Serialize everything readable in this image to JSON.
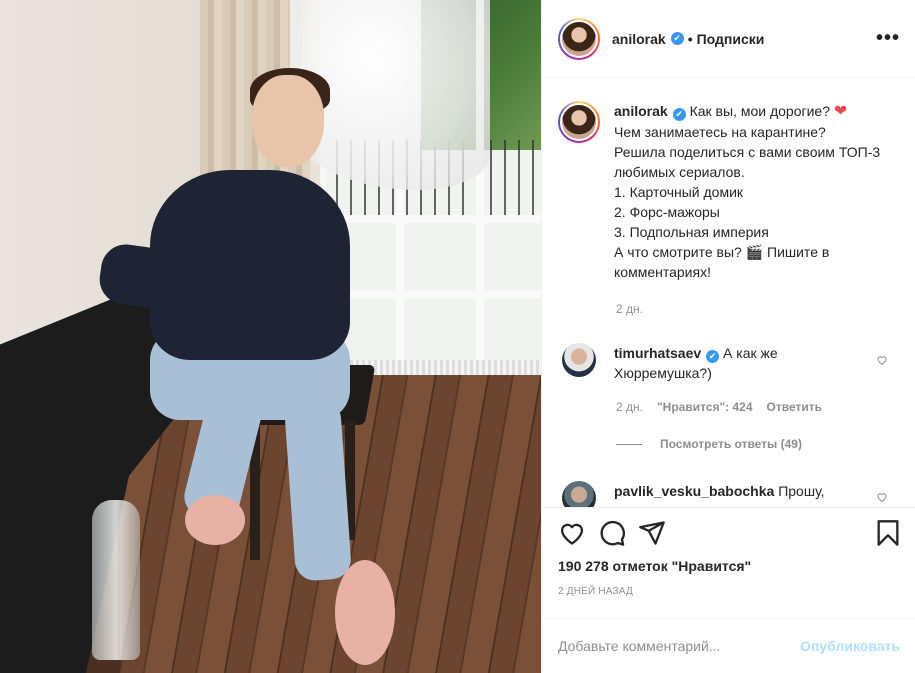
{
  "post": {
    "author": "anilorak",
    "follow_label": "Подписки",
    "more_glyph": "•••",
    "photo_icon": "post-photo"
  },
  "caption": {
    "username": "anilorak",
    "text": "Как вы, мои дорогие? ",
    "heart": "❤",
    "text_rest": "Чем занимаетесь на карантине?\nРешила поделиться с вами своим ТОП-3 любимых сериалов.\n1. Карточный домик\n2. Форс-мажоры\n3. Подпольная империя\nА что смотрите вы? 🎬 Пишите в комментариях!",
    "time": "2 дн."
  },
  "comments": [
    {
      "username": "timurhatsaev",
      "verified": true,
      "text": "А как же Хюрремушка?)",
      "time": "2 дн.",
      "likes": "\"Нравится\": 424",
      "reply": "Ответить"
    },
    {
      "username": "pavlik_vesku_babochka",
      "verified": false,
      "text": "Прошу,"
    }
  ],
  "replies_label": "Посмотреть ответы (49)",
  "stats": {
    "likes": "190 278 отметок \"Нравится\"",
    "date": "2 ДНЕЙ НАЗАД"
  },
  "add_comment": {
    "placeholder": "Добавьте комментарий...",
    "publish": "Опубликовать"
  },
  "colors": {
    "verified": "#3897f0",
    "heart": "#ed4956",
    "publish_disabled": "#b2dffc",
    "meta": "#8e8e8e"
  },
  "icons": [
    "heart-outline-icon",
    "comment-icon",
    "share-icon",
    "bookmark-icon",
    "verified-icon",
    "more-icon",
    "like-comment-icon"
  ]
}
